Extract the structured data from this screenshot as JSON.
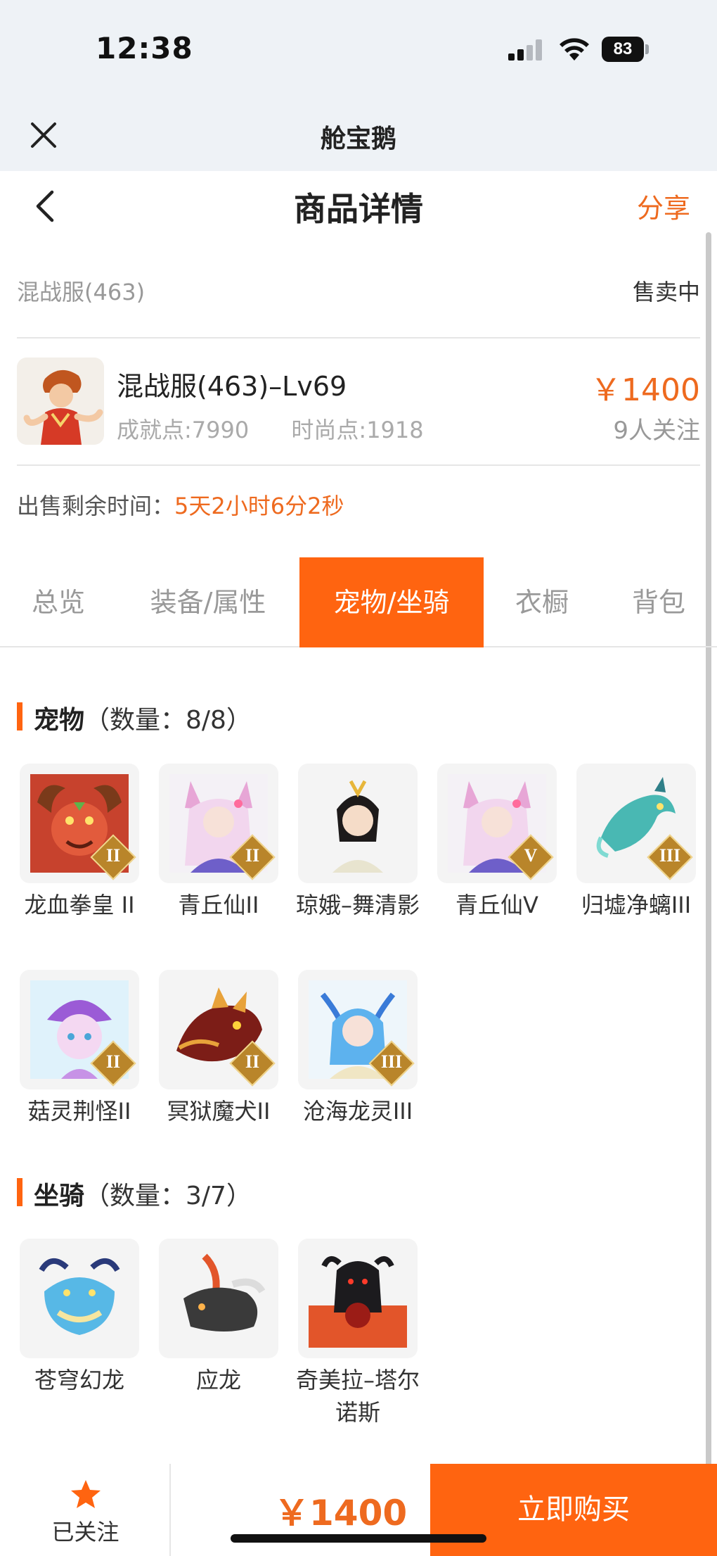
{
  "status_bar": {
    "time": "12:38",
    "battery": "83"
  },
  "app_bar": {
    "title": "舱宝鹅"
  },
  "nav": {
    "title": "商品详情",
    "share": "分享"
  },
  "server": {
    "name": "混战服(463)",
    "status": "售卖中"
  },
  "product": {
    "name": "混战服(463)–Lv69",
    "achievement": "成就点:7990",
    "fashion": "时尚点:1918",
    "price": "￥1400",
    "followers": "9人关注"
  },
  "remaining": {
    "label": "出售剩余时间：",
    "value": "5天2小时6分2秒"
  },
  "tabs": [
    "总览",
    "装备/属性",
    "宠物/坐骑",
    "衣橱",
    "背包"
  ],
  "active_tab": "宠物/坐骑",
  "pets": {
    "title": "宠物",
    "count": "（数量：8/8）",
    "items": [
      {
        "name": "龙血拳皇 II",
        "badge": "II",
        "icon": "red-dragon-icon"
      },
      {
        "name": "青丘仙II",
        "badge": "II",
        "icon": "fox-fairy-icon"
      },
      {
        "name": "琼娥–舞清影",
        "badge": "",
        "icon": "dancer-icon"
      },
      {
        "name": "青丘仙V",
        "badge": "V",
        "icon": "fox-fairy-icon"
      },
      {
        "name": "归墟净螭III",
        "badge": "III",
        "icon": "teal-dragon-icon"
      },
      {
        "name": "菇灵荆怪II",
        "badge": "II",
        "icon": "mushroom-sprite-icon"
      },
      {
        "name": "冥狱魔犬II",
        "badge": "II",
        "icon": "hell-hound-icon"
      },
      {
        "name": "沧海龙灵III",
        "badge": "III",
        "icon": "sea-dragon-girl-icon"
      }
    ]
  },
  "mounts": {
    "title": "坐骑",
    "count": "（数量：3/7）",
    "items": [
      {
        "name": "苍穹幻龙",
        "icon": "sky-dragon-icon"
      },
      {
        "name": "应龙",
        "icon": "winged-dragon-icon"
      },
      {
        "name": "奇美拉–塔尔诺斯",
        "icon": "chimera-icon"
      }
    ]
  },
  "bottom": {
    "follow_label": "已关注",
    "price": "￥1400",
    "buy_label": "立即购买"
  },
  "colors": {
    "accent": "#ff6410",
    "price": "#ee6a1f",
    "header_bg": "#eef2f6"
  }
}
